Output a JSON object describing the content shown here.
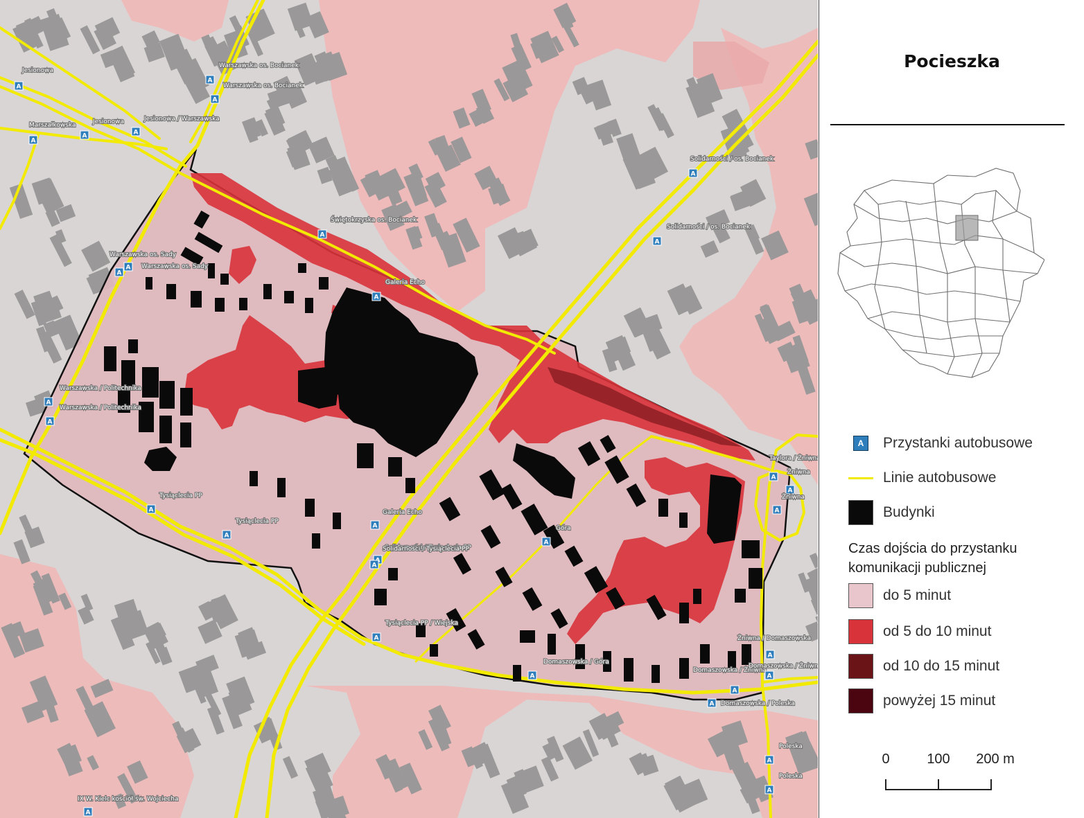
{
  "title": "Pocieszka",
  "colors": {
    "walk_0_5": "#e8c6cc",
    "walk_5_10": "#d8333a",
    "walk_10_15": "#6b1418",
    "walk_15_plus": "#4a0510",
    "bus_line": "#f2ea00",
    "building": "#0a0a0a",
    "bus_stop": "#2f7ebc"
  },
  "legend": {
    "stops": "Przystanki autobusowe",
    "lines": "Linie autobusowe",
    "buildings": "Budynki",
    "heading": "Czas dojścia do przystanku komunikacji publicznej",
    "classes": [
      {
        "label": "do 5 minut",
        "color": "#e8c6cc"
      },
      {
        "label": "od 5 do 10 minut",
        "color": "#d8333a"
      },
      {
        "label": "od 10 do 15 minut",
        "color": "#6b1418"
      },
      {
        "label": "powyżej 15 minut",
        "color": "#4a0510"
      }
    ]
  },
  "scale": {
    "labels": [
      "0",
      "100",
      "200 m"
    ]
  },
  "stop_icon": "A",
  "bus_stops": [
    "Jesionowa",
    "Warszawska os. Bocianek",
    "Warszawska os. Bocianek",
    "Marszałkowska",
    "Jesionowa",
    "Jesionowa / Warszawska",
    "Solidarności / os. Bocianek",
    "Świętokrzyska os. Bocianek",
    "Solidarności / os. Bocianek",
    "Warszawska os. Sady",
    "Warszawska os. Sady",
    "Galeria Echo",
    "Warszawska / Politechnika",
    "Warszawska / Politechnika",
    "Tysiąclecia PP",
    "Tysiąclecia PP",
    "Galeria Echo",
    "Solidarności / Tysiąclecia PP",
    "Góra",
    "Solidarności / Tysiąclecia PP",
    "Tysiąclecia PP / Wiejska",
    "Taylora / Żniwna",
    "Żniwna",
    "Żniwna",
    "Żniwna / Domaszowska",
    "Domaszowska / Żniwna",
    "Domaszowska / Góra",
    "Domaszowska / Żniwna",
    "Domaszowska / Poleska",
    "Poleska",
    "Poleska",
    "IX W. Kielc kościół św. Wojciecha"
  ]
}
